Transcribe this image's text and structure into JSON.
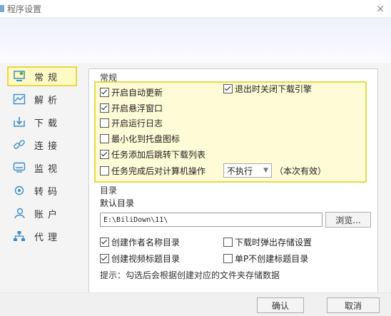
{
  "window": {
    "title": "程序设置",
    "close_label": "×"
  },
  "sidebar": {
    "items": [
      {
        "label": "常规",
        "icon": "general-settings-icon",
        "active": true
      },
      {
        "label": "解析",
        "icon": "parse-icon",
        "active": false
      },
      {
        "label": "下载",
        "icon": "download-icon",
        "active": false
      },
      {
        "label": "连接",
        "icon": "link-icon",
        "active": false
      },
      {
        "label": "监视",
        "icon": "monitor-icon",
        "active": false
      },
      {
        "label": "转码",
        "icon": "transcode-icon",
        "active": false
      },
      {
        "label": "账户",
        "icon": "account-icon",
        "active": false
      },
      {
        "label": "代理",
        "icon": "proxy-icon",
        "active": false
      }
    ]
  },
  "general": {
    "title": "常规",
    "options": {
      "auto_update": {
        "label": "开启自动更新",
        "checked": true
      },
      "close_engine": {
        "label": "退出时关闭下载引擎",
        "checked": true
      },
      "float_window": {
        "label": "开启悬浮窗口",
        "checked": true
      },
      "run_log": {
        "label": "开启运行日志",
        "checked": false
      },
      "minimize_tray": {
        "label": "最小化到托盘图标",
        "checked": false
      },
      "jump_list": {
        "label": "任务添加后跳转下载列表",
        "checked": true
      },
      "after_done": {
        "label": "任务完成后对计算机操作",
        "checked": false
      }
    },
    "action_select": {
      "value": "不执行"
    },
    "note": "（本次有效）"
  },
  "directory": {
    "title": "目录",
    "default_label": "默认目录",
    "path_value": "E:\\BiliDown\\11\\",
    "browse_label": "浏览...",
    "options": {
      "author_dir": {
        "label": "创建作者名称目录",
        "checked": true
      },
      "popup_dir": {
        "label": "下载时弹出存储设置",
        "checked": false
      },
      "title_dir": {
        "label": "创建视频标题目录",
        "checked": true
      },
      "single_p": {
        "label": "单P不创建标题目录",
        "checked": false
      }
    },
    "hint": "提示：勾选后会根据创建对应的文件夹存储数据"
  },
  "footer": {
    "ok_label": "确认",
    "cancel_label": "取消"
  },
  "colors": {
    "highlight_border": "#e8d84a",
    "highlight_fill": "#fffbd6",
    "accent": "#3c8dc9"
  }
}
